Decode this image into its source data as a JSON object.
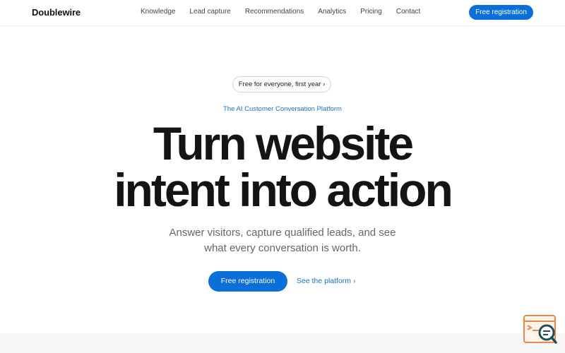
{
  "header": {
    "logo": "Doublewire",
    "nav": [
      "Knowledge",
      "Lead capture",
      "Recommendations",
      "Analytics",
      "Pricing",
      "Contact"
    ],
    "cta_label": "Free registration"
  },
  "hero": {
    "pill_label": "Free for everyone, first year ›",
    "eyebrow": "The AI Customer Conversation Platform",
    "headline_line1": "Turn website",
    "headline_line2": "intent into action",
    "subhead_line1": "Answer visitors, capture qualified leads, and see",
    "subhead_line2": "what every conversation is worth.",
    "primary_cta": "Free registration",
    "secondary_cta": "See the platform ›"
  },
  "widget": {
    "icon": "search-chat-icon"
  },
  "colors": {
    "accent": "#0a6fd8",
    "link": "#1a6fc8",
    "widget_orange": "#e8894a",
    "widget_teal": "#1f4e5a"
  }
}
